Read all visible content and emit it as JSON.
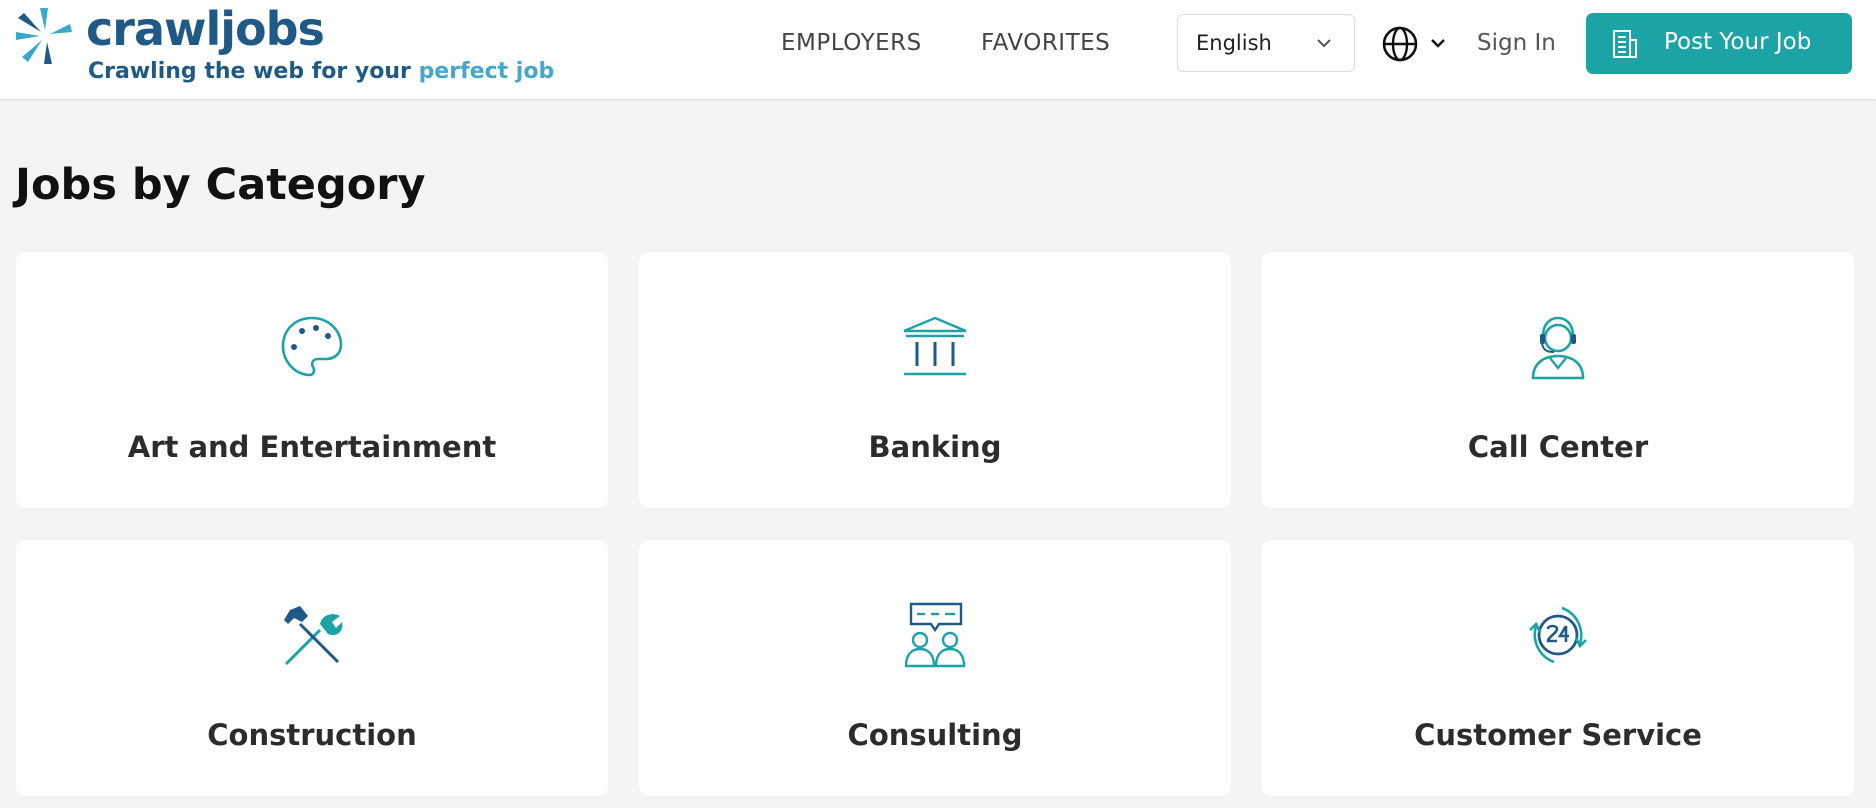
{
  "brand": {
    "name": "crawljobs",
    "tagline_prefix": "Crawling the web for your",
    "tagline_highlight": "perfect job",
    "primary_color": "#1f5a86",
    "accent_color": "#45a8c8"
  },
  "nav": {
    "employers": "EMPLOYERS",
    "favorites": "FAVORITES",
    "language_selected": "English",
    "language_icon": "globe-icon",
    "sign_in": "Sign In",
    "post_job": "Post Your Job",
    "post_job_color": "#1ba3a6"
  },
  "page": {
    "title": "Jobs by Category"
  },
  "categories": [
    {
      "label": "Art and Entertainment",
      "icon": "palette-icon"
    },
    {
      "label": "Banking",
      "icon": "bank-icon"
    },
    {
      "label": "Call Center",
      "icon": "headset-agent-icon"
    },
    {
      "label": "Construction",
      "icon": "hammer-wrench-icon"
    },
    {
      "label": "Consulting",
      "icon": "consulting-people-icon"
    },
    {
      "label": "Customer Service",
      "icon": "support-24-icon"
    }
  ]
}
